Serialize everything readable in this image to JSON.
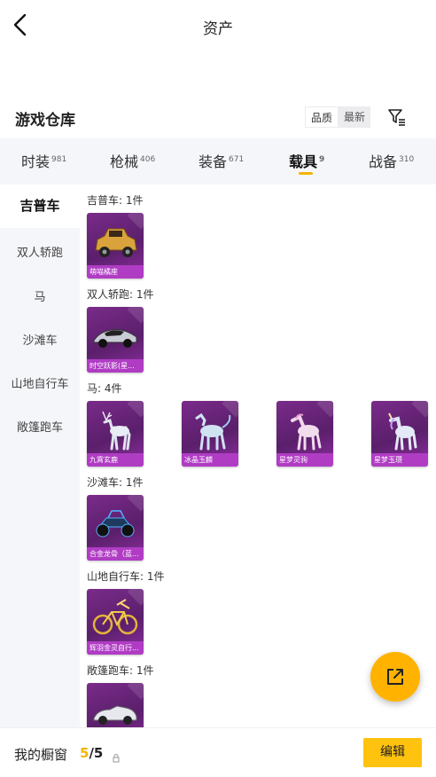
{
  "header": {
    "title": "资产"
  },
  "warehouse": {
    "title": "游戏仓库",
    "sort_quality": "品质",
    "sort_latest": "最新"
  },
  "tabs": [
    {
      "label": "时装",
      "count": "981"
    },
    {
      "label": "枪械",
      "count": "406"
    },
    {
      "label": "装备",
      "count": "671"
    },
    {
      "label": "载具",
      "count": "9"
    },
    {
      "label": "战备",
      "count": "310"
    }
  ],
  "active_tab": "载具",
  "sidebar": {
    "items": [
      {
        "label": "吉普车"
      },
      {
        "label": "双人轿跑"
      },
      {
        "label": "马"
      },
      {
        "label": "沙滩车"
      },
      {
        "label": "山地自行车"
      },
      {
        "label": "敞篷跑车"
      }
    ]
  },
  "sections": [
    {
      "title": "吉普车: 1件",
      "items": [
        {
          "name": "萌喵橘座",
          "icon": "jeep-icon"
        }
      ]
    },
    {
      "title": "双人轿跑: 1件",
      "items": [
        {
          "name": "时空跃影(星...",
          "icon": "coupe-icon"
        }
      ]
    },
    {
      "title": "马: 4件",
      "items": [
        {
          "name": "九霄玄鹿",
          "icon": "deer-icon"
        },
        {
          "name": "冰晶玉麟",
          "icon": "qilin-icon"
        },
        {
          "name": "星梦灵驹",
          "icon": "horse-icon"
        },
        {
          "name": "星梦玉瓒",
          "icon": "unicorn-icon"
        }
      ]
    },
    {
      "title": "沙滩车: 1件",
      "items": [
        {
          "name": "合金龙骨（蓝...",
          "icon": "buggy-icon"
        }
      ]
    },
    {
      "title": "山地自行车: 1件",
      "items": [
        {
          "name": "辉羽金灵自行...",
          "icon": "bicycle-icon"
        }
      ]
    },
    {
      "title": "敞篷跑车: 1件",
      "items": [
        {
          "name": "",
          "icon": "convertible-icon"
        }
      ]
    }
  ],
  "bottom": {
    "label": "我的橱窗",
    "current": "5",
    "separator": "/",
    "total": "5",
    "edit": "编辑"
  },
  "colors": {
    "accent": "#ffc20e",
    "card_bg": "#6a2479",
    "card_label": "#b03cc4"
  }
}
